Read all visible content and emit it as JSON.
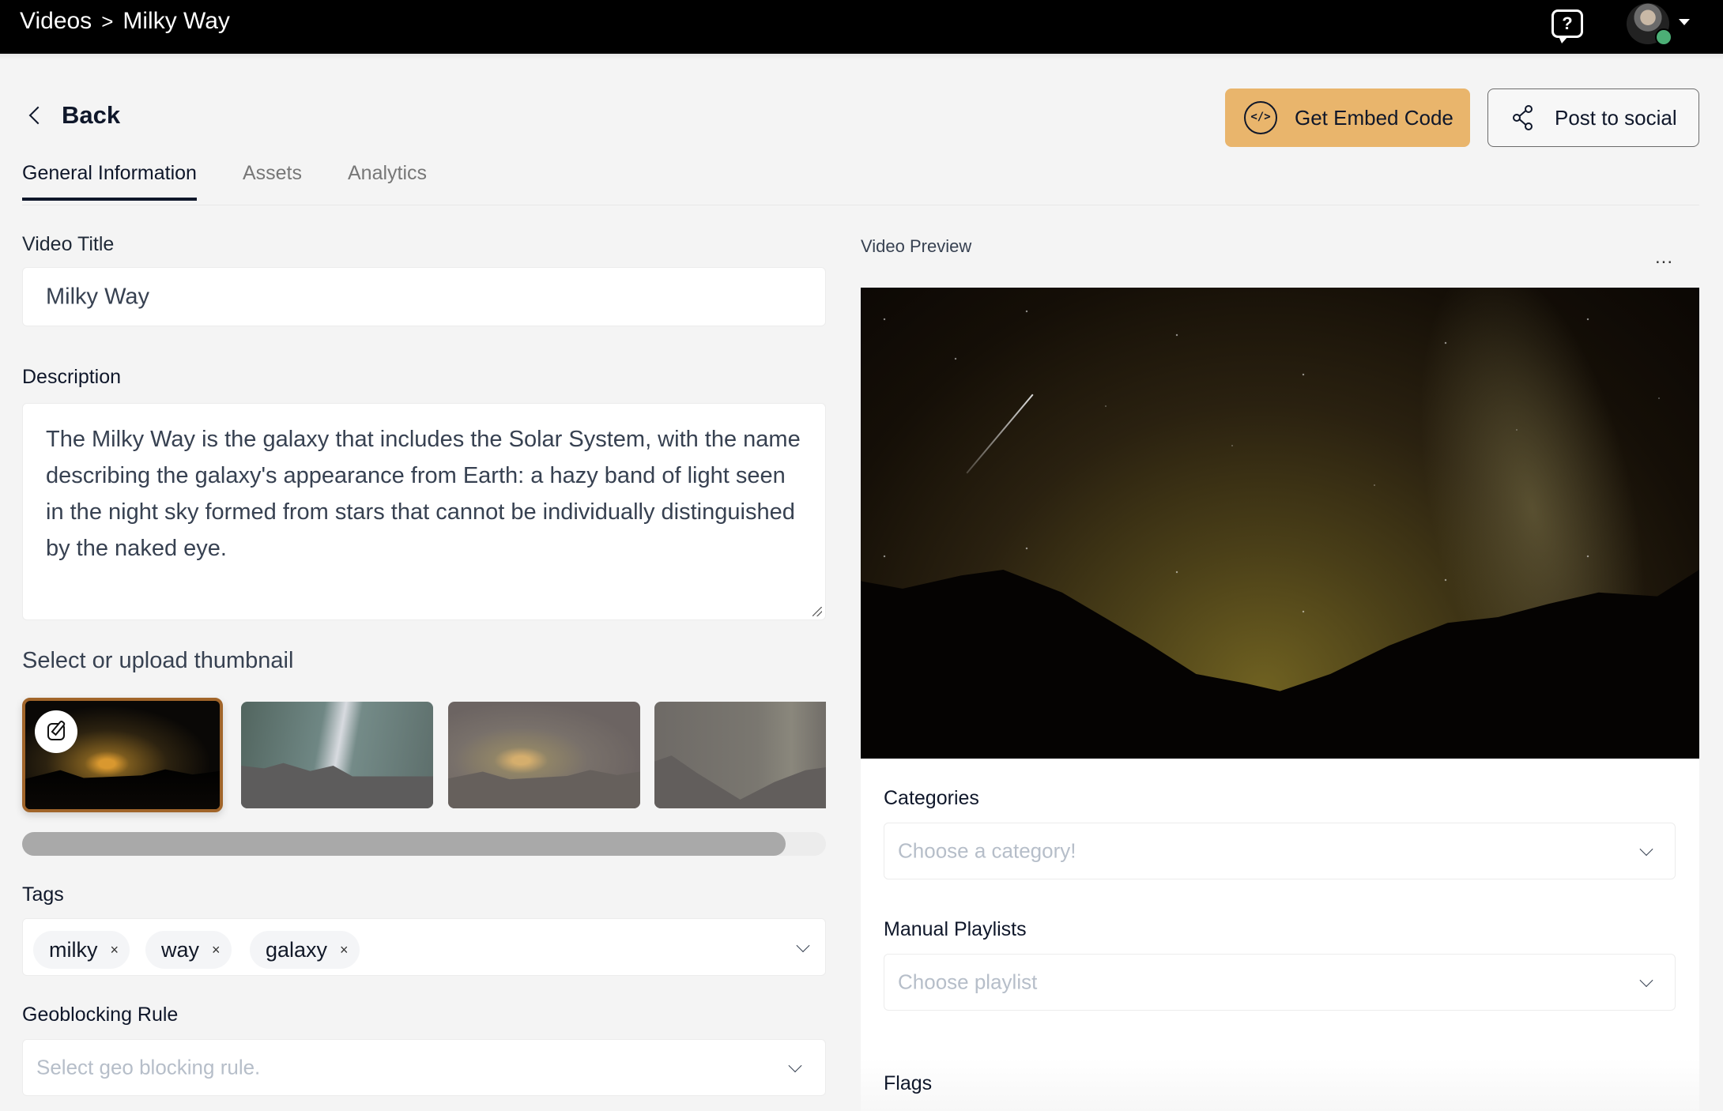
{
  "header": {
    "breadcrumb": [
      "Videos",
      "Milky Way"
    ],
    "breadcrumb_separator": ">",
    "help_icon": "?",
    "online_status_color": "#4caf76"
  },
  "actions": {
    "back_label": "Back",
    "embed_label": "Get Embed Code",
    "embed_icon": "</>",
    "social_label": "Post to social",
    "embed_color": "#e9b56c"
  },
  "tabs": [
    {
      "label": "General Information",
      "active": true
    },
    {
      "label": "Assets",
      "active": false
    },
    {
      "label": "Analytics",
      "active": false
    }
  ],
  "form": {
    "title_label": "Video Title",
    "title_value": "Milky Way",
    "description_label": "Description",
    "description_value": "The Milky Way is the galaxy that includes the Solar System, with the name describing the galaxy's appearance from Earth: a hazy band of light seen in the night sky formed from stars that cannot be individually distinguished by the naked eye.",
    "thumbnail_label": "Select or upload thumbnail",
    "thumbnail_selected_index": 0,
    "thumbnail_count_visible": 4,
    "thumbnail_scroll_fraction": 0.95,
    "tags_label": "Tags",
    "tags": [
      "milky",
      "way",
      "galaxy"
    ],
    "tag_remove_glyph": "×",
    "geoblocking_label": "Geoblocking Rule",
    "geoblocking_placeholder": "Select geo blocking rule."
  },
  "preview": {
    "label": "Video Preview",
    "menu_glyph": "...",
    "categories_label": "Categories",
    "categories_placeholder": "Choose a category!",
    "playlists_label": "Manual Playlists",
    "playlists_placeholder": "Choose playlist",
    "flags_label": "Flags"
  }
}
